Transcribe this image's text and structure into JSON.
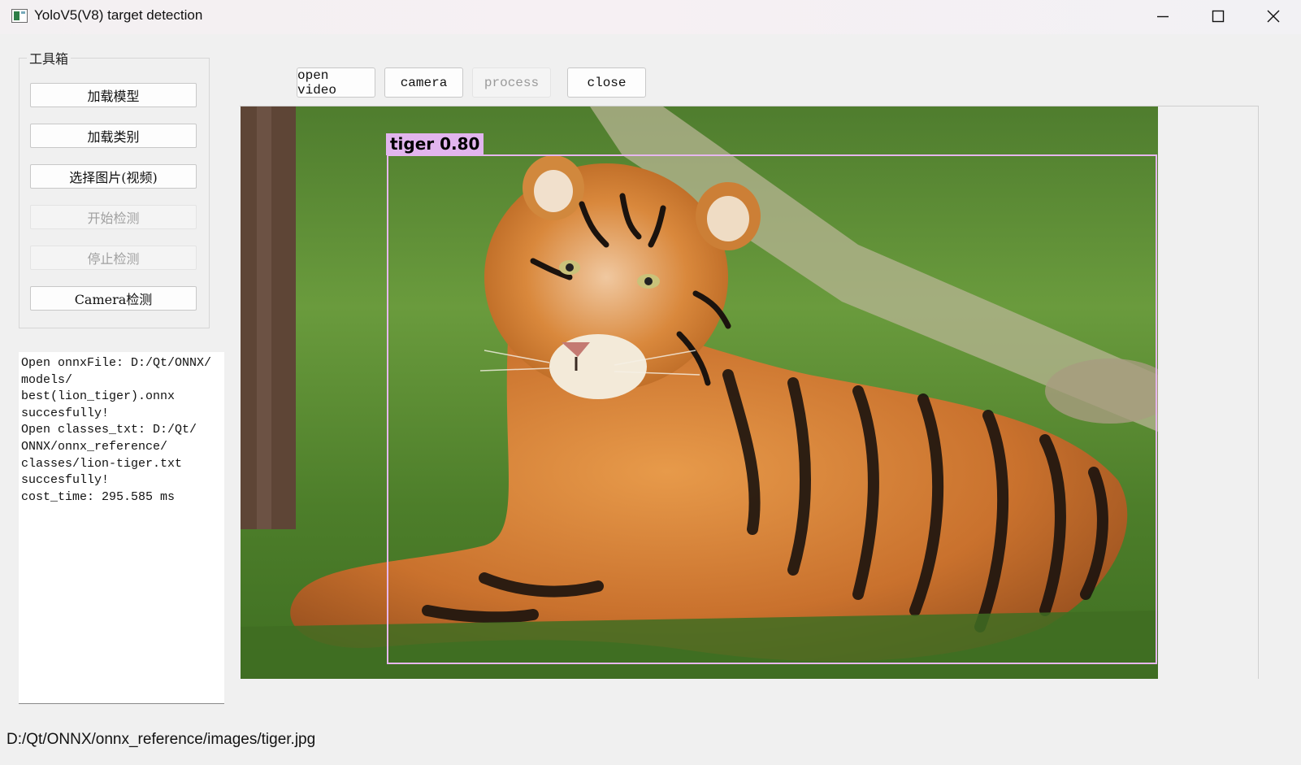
{
  "window": {
    "title": "YoloV5(V8) target detection"
  },
  "toolbox": {
    "title": "工具箱",
    "buttons": [
      {
        "label": "加载模型",
        "enabled": true
      },
      {
        "label": "加载类别",
        "enabled": true
      },
      {
        "label": "选择图片(视频)",
        "enabled": true
      },
      {
        "label": "开始检测",
        "enabled": false
      },
      {
        "label": "停止检测",
        "enabled": false
      },
      {
        "label": "Camera检测",
        "enabled": true
      }
    ]
  },
  "top_buttons": [
    {
      "label": "open video",
      "enabled": true
    },
    {
      "label": "camera",
      "enabled": true
    },
    {
      "label": "process",
      "enabled": false
    },
    {
      "label": "close",
      "enabled": true
    }
  ],
  "log": {
    "lines": [
      "Open onnxFile: D:/Qt/ONNX/",
      "models/",
      "best(lion_tiger).onnx",
      "succesfully!",
      "Open classes_txt: D:/Qt/",
      "ONNX/onnx_reference/",
      "classes/lion-tiger.txt",
      "succesfully!",
      "cost_time: 295.585 ms"
    ]
  },
  "detection": {
    "label": "tiger 0.80",
    "box_color": "#e6b7ee",
    "image_subject": "tiger"
  },
  "status_bar": {
    "path": "D:/Qt/ONNX/onnx_reference/images/tiger.jpg"
  }
}
